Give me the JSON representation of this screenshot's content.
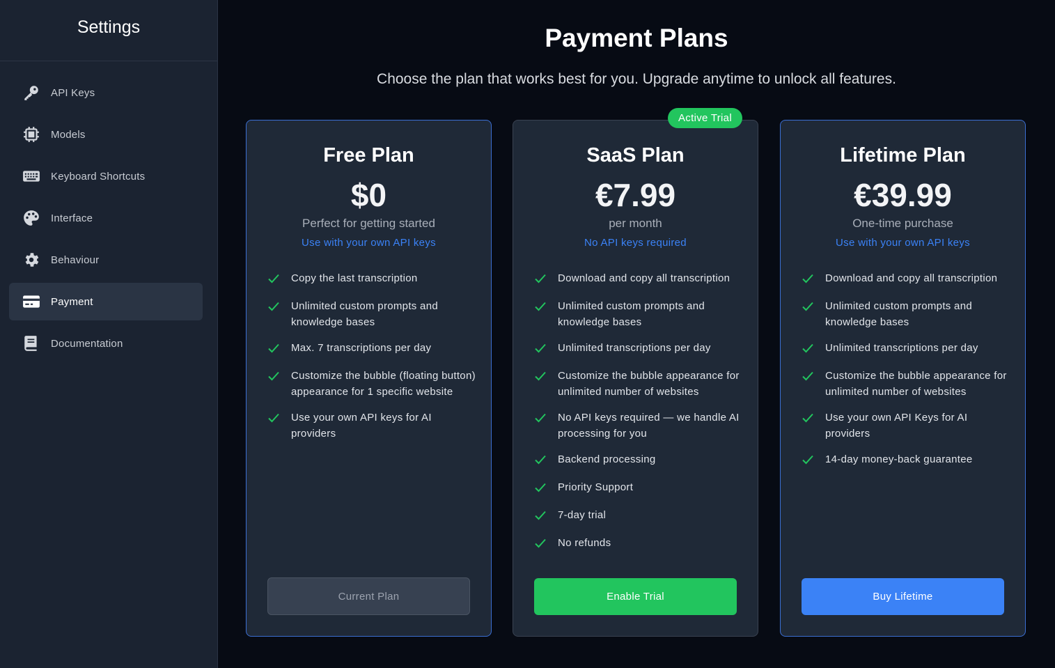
{
  "sidebar": {
    "title": "Settings",
    "items": [
      {
        "label": "API Keys",
        "icon": "key-icon"
      },
      {
        "label": "Models",
        "icon": "chip-icon"
      },
      {
        "label": "Keyboard Shortcuts",
        "icon": "keyboard-icon"
      },
      {
        "label": "Interface",
        "icon": "palette-icon"
      },
      {
        "label": "Behaviour",
        "icon": "gear-icon"
      },
      {
        "label": "Payment",
        "icon": "credit-card-icon",
        "active": true
      },
      {
        "label": "Documentation",
        "icon": "book-icon"
      }
    ]
  },
  "main": {
    "title": "Payment Plans",
    "subtitle": "Choose the plan that works best for you. Upgrade anytime to unlock all features."
  },
  "plans": [
    {
      "name": "Free Plan",
      "price": "$0",
      "description": "Perfect for getting started",
      "note": "Use with your own API keys",
      "features": [
        "Copy the last transcription",
        "Unlimited custom prompts and knowledge bases",
        "Max. 7 transcriptions per day",
        "Customize the bubble (floating button) appearance for 1 specific website",
        "Use your own API keys for AI providers"
      ],
      "button": "Current Plan"
    },
    {
      "name": "SaaS Plan",
      "badge": "Active Trial",
      "price": "€7.99",
      "description": "per month",
      "note": "No API keys required",
      "features": [
        "Download and copy all transcription",
        "Unlimited custom prompts and knowledge bases",
        "Unlimited transcriptions per day",
        "Customize the bubble appearance for unlimited number of websites",
        "No API keys required — we handle AI processing for you",
        "Backend processing",
        "Priority Support",
        "7-day trial",
        "No refunds"
      ],
      "button": "Enable Trial"
    },
    {
      "name": "Lifetime Plan",
      "price": "€39.99",
      "description": "One-time purchase",
      "note": "Use with your own API keys",
      "features": [
        "Download and copy all transcription",
        "Unlimited custom prompts and knowledge bases",
        "Unlimited transcriptions per day",
        "Customize the bubble appearance for unlimited number of websites",
        "Use your own API Keys for AI providers",
        "14-day money-back guarantee"
      ],
      "button": "Buy Lifetime"
    }
  ],
  "colors": {
    "accent_blue": "#3b82f6",
    "accent_green": "#22c55e",
    "card_bg": "#1f2937",
    "sidebar_bg": "#1b2331"
  }
}
